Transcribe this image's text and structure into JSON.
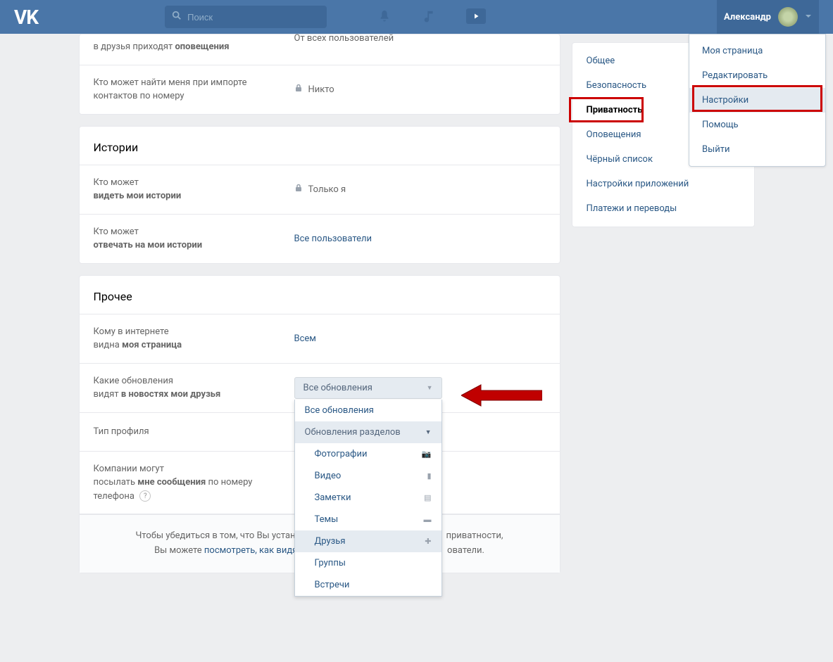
{
  "header": {
    "logo": "VK",
    "search_placeholder": "Поиск",
    "username": "Александр"
  },
  "dropdown_menu": {
    "items": [
      "Моя страница",
      "Редактировать",
      "Настройки",
      "Помощь",
      "Выйти"
    ],
    "highlighted_index": 2
  },
  "sidebar": {
    "items": [
      "Общее",
      "Безопасность",
      "Приватность",
      "Оповещения",
      "Чёрный список",
      "Настройки приложений",
      "Платежи и переводы"
    ],
    "active_index": 2
  },
  "settings_top": {
    "row1": {
      "label_start": "в друзья приходят ",
      "label_bold": "оповещения",
      "value": "От всех пользователей"
    },
    "row2": {
      "label": "Кто может найти меня при импорте контактов по номеру",
      "value": "Никто"
    }
  },
  "stories": {
    "title": "Истории",
    "row1": {
      "label_start": "Кто может",
      "label_bold": "видеть мои истории",
      "value": "Только я"
    },
    "row2": {
      "label_start": "Кто может",
      "label_bold": "отвечать на мои истории",
      "value": "Все пользователи"
    }
  },
  "other": {
    "title": "Прочее",
    "row1": {
      "label_start": "Кому в интернете",
      "label_end": "видна ",
      "label_bold": "моя страница",
      "value": "Всем"
    },
    "row2": {
      "label_start": "Какие обновления",
      "label_end": "видят ",
      "label_bold": "в новостях мои друзья"
    },
    "row3": {
      "label": "Тип профиля"
    },
    "row4": {
      "label_start": "Компании могут",
      "label_end": "посылать ",
      "label_bold": "мне сообщения",
      "label_trail": " по номеру телефона"
    }
  },
  "updates_dropdown": {
    "selected": "Все обновления",
    "options": [
      {
        "label": "Все обновления",
        "type": "plain"
      },
      {
        "label": "Обновления разделов",
        "type": "header"
      },
      {
        "label": "Фотографии",
        "type": "sub",
        "icon": "camera"
      },
      {
        "label": "Видео",
        "type": "sub",
        "icon": "film"
      },
      {
        "label": "Заметки",
        "type": "sub",
        "icon": "note"
      },
      {
        "label": "Темы",
        "type": "sub",
        "icon": "chat"
      },
      {
        "label": "Друзья",
        "type": "sub",
        "icon": "plus",
        "highlight": true
      },
      {
        "label": "Группы",
        "type": "sub"
      },
      {
        "label": "Встречи",
        "type": "sub"
      }
    ]
  },
  "footer": {
    "text_before": "Чтобы убедиться в том, что Вы устано",
    "text_gap1": "приватности,",
    "text_line2_before": "Вы можете ",
    "link1": "посмотреть, как видят",
    "text_gap2": "ователи."
  },
  "colors": {
    "accent": "#2a5885",
    "header_bg": "#4a76a8",
    "red": "#c00"
  }
}
